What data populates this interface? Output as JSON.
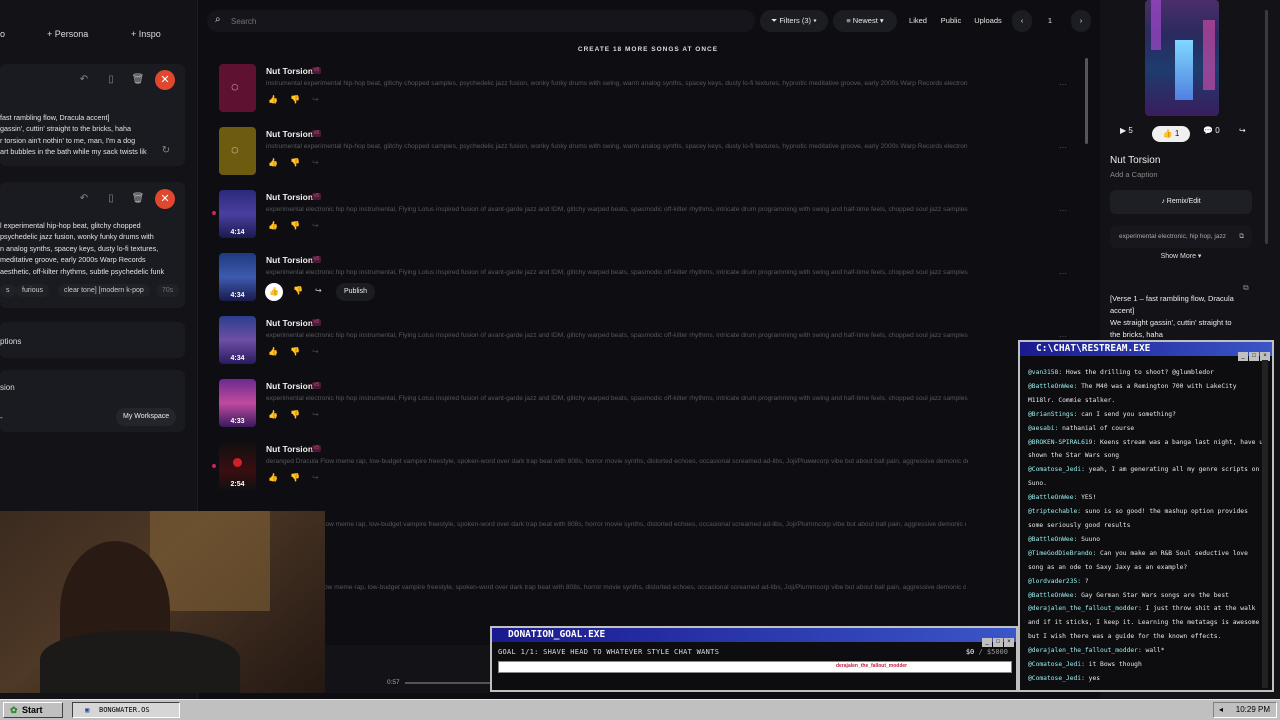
{
  "left_panel": {
    "tabs": {
      "a": "o",
      "persona": "Persona",
      "inspo": "Inspo"
    },
    "card1_lyrics": [
      "fast rambling flow, Dracula accent]",
      "gassin', cuttin' straight to the bricks, haha",
      "r torsion ain't nothin' to me, man, I'm a dog",
      "art bubbles in the bath while my sack twists lik"
    ],
    "card2_lyrics": [
      "l experimental hip-hop beat, glitchy chopped",
      "psychedelic jazz fusion, wonky funky drums with",
      "n analog synths, spacey keys, dusty lo-fi textures,",
      "meditative groove, early 2000s Warp Records",
      "aesthetic, off-kilter rhythms, subtle psychedelic funk"
    ],
    "chips": [
      "s",
      "furious",
      "clear tone] [modern k-pop",
      "70s"
    ],
    "row_options": "ptions",
    "row_sion": "sion",
    "row_dash": "-",
    "workspace": "My Workspace"
  },
  "topbar": {
    "search_placeholder": "Search",
    "filters": "Filters (3)",
    "newest": "Newest",
    "liked": "Liked",
    "public": "Public",
    "uploads": "Uploads",
    "page": "1"
  },
  "create_banner": "CREATE 18 MORE SONGS AT ONCE",
  "songs": [
    {
      "title": "Nut Torsion",
      "desc": "instrumental experimental hip-hop beat, glitchy chopped samples, psychedelic jazz fusion, wonky funky drums with swing, warm analog synths, spacey keys, dusty lo-fi textures, hypnotic meditative groove, early 2000s Warp Records electronic ...",
      "duration": ""
    },
    {
      "title": "Nut Torsion",
      "desc": "instrumental experimental hip-hop beat, glitchy chopped samples, psychedelic jazz fusion, wonky funky drums with swing, warm analog synths, spacey keys, dusty lo-fi textures, hypnotic meditative groove, early 2000s Warp Records electronic ...",
      "duration": ""
    },
    {
      "title": "Nut Torsion",
      "desc": "experimental electronic hip hop instrumental, Flying Lotus inspired fusion of avant-garde jazz and IDM, glitchy warped beats, spasmodic off-kilter rhythms, intricate drum programming with swing and half-time feels, chopped soul jazz samples, c...",
      "duration": "4:14"
    },
    {
      "title": "Nut Torsion",
      "desc": "experimental electronic hip hop instrumental, Flying Lotus inspired fusion of avant-garde jazz and IDM, glitchy warped beats, spasmodic off-kilter rhythms, intricate drum programming with swing and half-time feels, chopped soul jazz samples, c...",
      "duration": "4:34"
    },
    {
      "title": "Nut Torsion",
      "desc": "experimental electronic hip hop instrumental, Flying Lotus inspired fusion of avant-garde jazz and IDM, glitchy warped beats, spasmodic off-kilter rhythms, intricate drum programming with swing and half-time feels, chopped soul jazz samples, c...",
      "duration": "4:34"
    },
    {
      "title": "Nut Torsion",
      "desc": "experimental electronic hip hop instrumental, Flying Lotus inspired fusion of avant-garde jazz and IDM, glitchy warped beats, spasmodic off-kilter rhythms, intricate drum programming with swing and half-time feels, chopped soul jazz samples, c...",
      "duration": "4:33"
    },
    {
      "title": "Nut Torsion",
      "desc": "deranged Dracula Flow meme rap, low-budget vampire freestyle, spoken-word over dark trap beat with 808s, horror movie synths, distorted echoes, occasional screamed ad-libs, Joji/Pluммcorp vibe but about ball pain, aggressive demonic de...",
      "duration": "2:54"
    }
  ],
  "hidden_desc_1": "low meme rap, low-budget vampire freestyle, spoken-word over dark trap beat with 808s, horror movie synths, distorted echoes, occasional screamed ad-libs, Joji/Plummcorp vibe but about ball pain, aggressive demonic de...",
  "hidden_desc_2": "ow meme rap, low-budget vampire freestyle, spoken-word over dark trap beat with 808s, horror movie synths, distorted echoes, occasional screamed ad-libs, Joji/Plummcorp vibe but about ball pain, aggressive demonic de...",
  "publish": "Publish",
  "right_panel": {
    "plays": "5",
    "likes": "1",
    "comments": "0",
    "title": "Nut Torsion",
    "caption": "Add a Caption",
    "remix": "Remix/Edit",
    "tags": "experimental electronic, hip hop, jazz",
    "show_more": "Show More",
    "lyrics": [
      "[Verse 1 – fast rambling flow, Dracula",
      "accent]",
      "We straight gassin', cuttin' straight to",
      "the bricks, haha"
    ]
  },
  "chat_window": {
    "title": "C:\\CHAT\\RESTREAM.EXE",
    "messages": [
      {
        "user": "@van3158",
        "text": "Hows the drilling to shoot? @glumbledor"
      },
      {
        "user": "@BattleOnWee",
        "text": "The M40 was a Remington 700 with LakeCity M118lr. Commie stalker."
      },
      {
        "user": "@BrianStings",
        "text": "can I send you something?"
      },
      {
        "user": "@aesabi",
        "text": "nathanial of course"
      },
      {
        "user": "@BROKEN-SPIRAL619",
        "text": "Keens stream was a banga last night, have u shown the Star Wars song"
      },
      {
        "user": "@Comatose_Jedi",
        "text": "yeah, I am generating all my genre scripts on Suno."
      },
      {
        "user": "@BattleOnWee",
        "text": "YES!"
      },
      {
        "user": "@triptechable",
        "text": "suno is so good! the mashup option provides some seriously good results"
      },
      {
        "user": "@BattleOnWee",
        "text": "Suuno"
      },
      {
        "user": "@TimeGodDieBrando",
        "text": "Can you make an R&B Soul seductive love song as an ode to Saxy Jaxy as an example?"
      },
      {
        "user": "@lordvader235",
        "text": "?"
      },
      {
        "user": "@BattleOnWee",
        "text": "Gay German Star Wars songs are the best"
      },
      {
        "user": "@derajalen_the_fallout_modder",
        "text": "I just throw shit at the walk and if it sticks, I keep it. Learning the metatags is awesome but I wish there was a guide for the known effects."
      },
      {
        "user": "@derajalen_the_fallout_modder",
        "text": "wall*"
      },
      {
        "user": "@Comatose_Jedi",
        "text": "it Bows though"
      },
      {
        "user": "@Comatose_Jedi",
        "text": "yes"
      }
    ]
  },
  "donation": {
    "title": "DONATION_GOAL.EXE",
    "goal": "GOAL 1/1: SHAVE HEAD TO WHATEVER STYLE CHAT WANTS",
    "amount_current": "$0",
    "amount_target": "/ $5000",
    "progress": 0,
    "bar_text": "derajalen_the_fallout_modder"
  },
  "player": {
    "time": "0:57"
  },
  "taskbar": {
    "start": "Start",
    "item": "BONGWATER.OS",
    "clock": "10:29 PM"
  },
  "colors": {
    "accent_red": "#e0472f",
    "win_title": "#1a1a8e"
  }
}
